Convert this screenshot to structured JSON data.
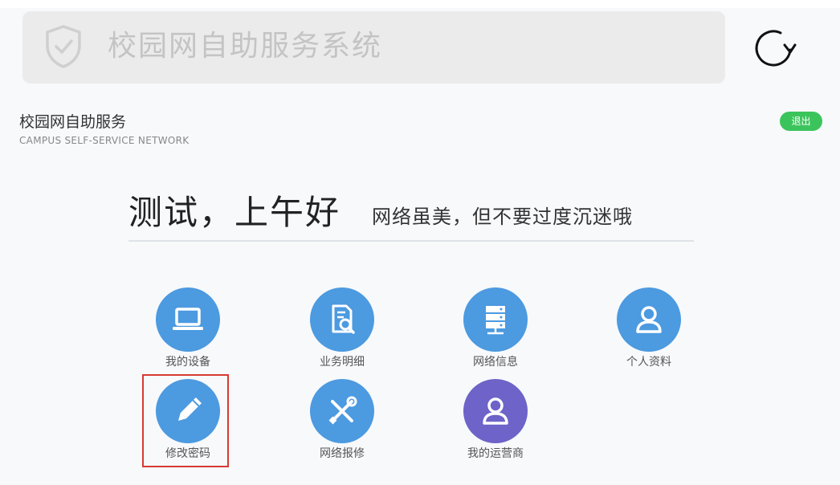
{
  "header": {
    "app_title": "校园网自助服务系统"
  },
  "brand": {
    "name_cn": "校园网自助服务",
    "name_en": "CAMPUS  SELF-SERVICE NETWORK"
  },
  "actions": {
    "logout_label": "退出"
  },
  "welcome": {
    "greeting": "测试，上午好",
    "motto": "网络虽美，但不要过度沉迷哦"
  },
  "tiles": [
    {
      "label": "我的设备",
      "icon": "laptop-icon"
    },
    {
      "label": "业务明细",
      "icon": "document-search-icon"
    },
    {
      "label": "网络信息",
      "icon": "server-icon"
    },
    {
      "label": "个人资料",
      "icon": "user-icon"
    },
    {
      "label": "修改密码",
      "icon": "pencil-icon"
    },
    {
      "label": "网络报修",
      "icon": "tools-icon"
    },
    {
      "label": "我的运营商",
      "icon": "user-icon"
    }
  ],
  "colors": {
    "tile_blue": "#4c9ae0",
    "tile_purple": "#6d63c8",
    "logout_green": "#3cc45c",
    "highlight_red": "#d83a32"
  }
}
